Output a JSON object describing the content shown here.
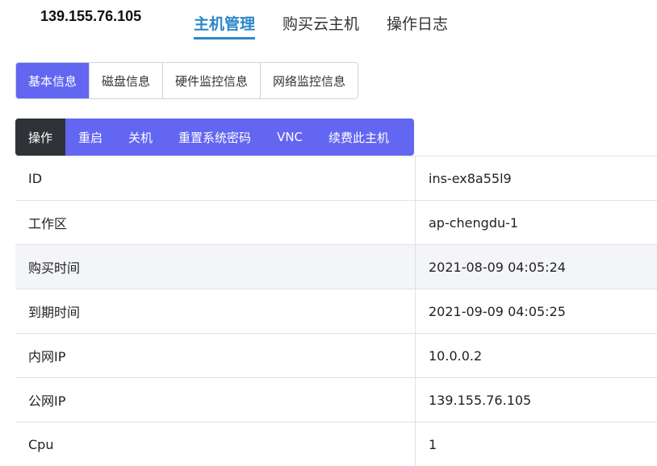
{
  "header": {
    "ip": "139.155.76.105",
    "nav": [
      {
        "label": "主机管理",
        "active": true
      },
      {
        "label": "购买云主机",
        "active": false
      },
      {
        "label": "操作日志",
        "active": false
      }
    ]
  },
  "tabs": [
    {
      "label": "基本信息",
      "active": true
    },
    {
      "label": "磁盘信息",
      "active": false
    },
    {
      "label": "硬件监控信息",
      "active": false
    },
    {
      "label": "网络监控信息",
      "active": false
    }
  ],
  "actions": [
    "操作",
    "重启",
    "关机",
    "重置系统密码",
    "VNC",
    "续费此主机"
  ],
  "info_rows": [
    {
      "label": "ID",
      "value": "ins-ex8a55l9"
    },
    {
      "label": "工作区",
      "value": "ap-chengdu-1"
    },
    {
      "label": "购买时间",
      "value": "2021-08-09 04:05:24"
    },
    {
      "label": "到期时间",
      "value": "2021-09-09 04:05:25"
    },
    {
      "label": "内网IP",
      "value": "10.0.0.2"
    },
    {
      "label": "公网IP",
      "value": "139.155.76.105"
    },
    {
      "label": "Cpu",
      "value": "1"
    }
  ],
  "colors": {
    "accent": "#6366f1",
    "nav_active": "#2c87c9",
    "action_dark": "#2f3338"
  }
}
